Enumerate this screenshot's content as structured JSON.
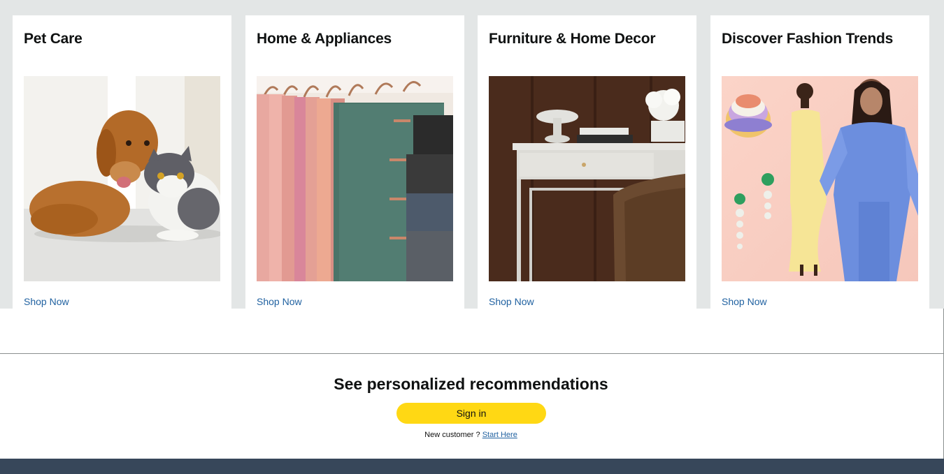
{
  "cards": [
    {
      "title": "Pet Care",
      "link": "Shop Now",
      "image": "dog-and-cat-photo"
    },
    {
      "title": "Home & Appliances",
      "link": "Shop Now",
      "image": "hanging-fabric-photo"
    },
    {
      "title": "Furniture & Home Decor",
      "link": "Shop Now",
      "image": "desk-and-chair-photo"
    },
    {
      "title": "Discover Fashion Trends",
      "link": "Shop Now",
      "image": "fashion-models-photo"
    }
  ],
  "signin": {
    "heading": "See personalized recommendations",
    "button": "Sign in",
    "new_customer": "New customer ?",
    "start_here": "Start Here"
  },
  "colors": {
    "band": "#e3e6e6",
    "link": "#2162a1",
    "button": "#ffd814",
    "footer": "#37475a"
  }
}
